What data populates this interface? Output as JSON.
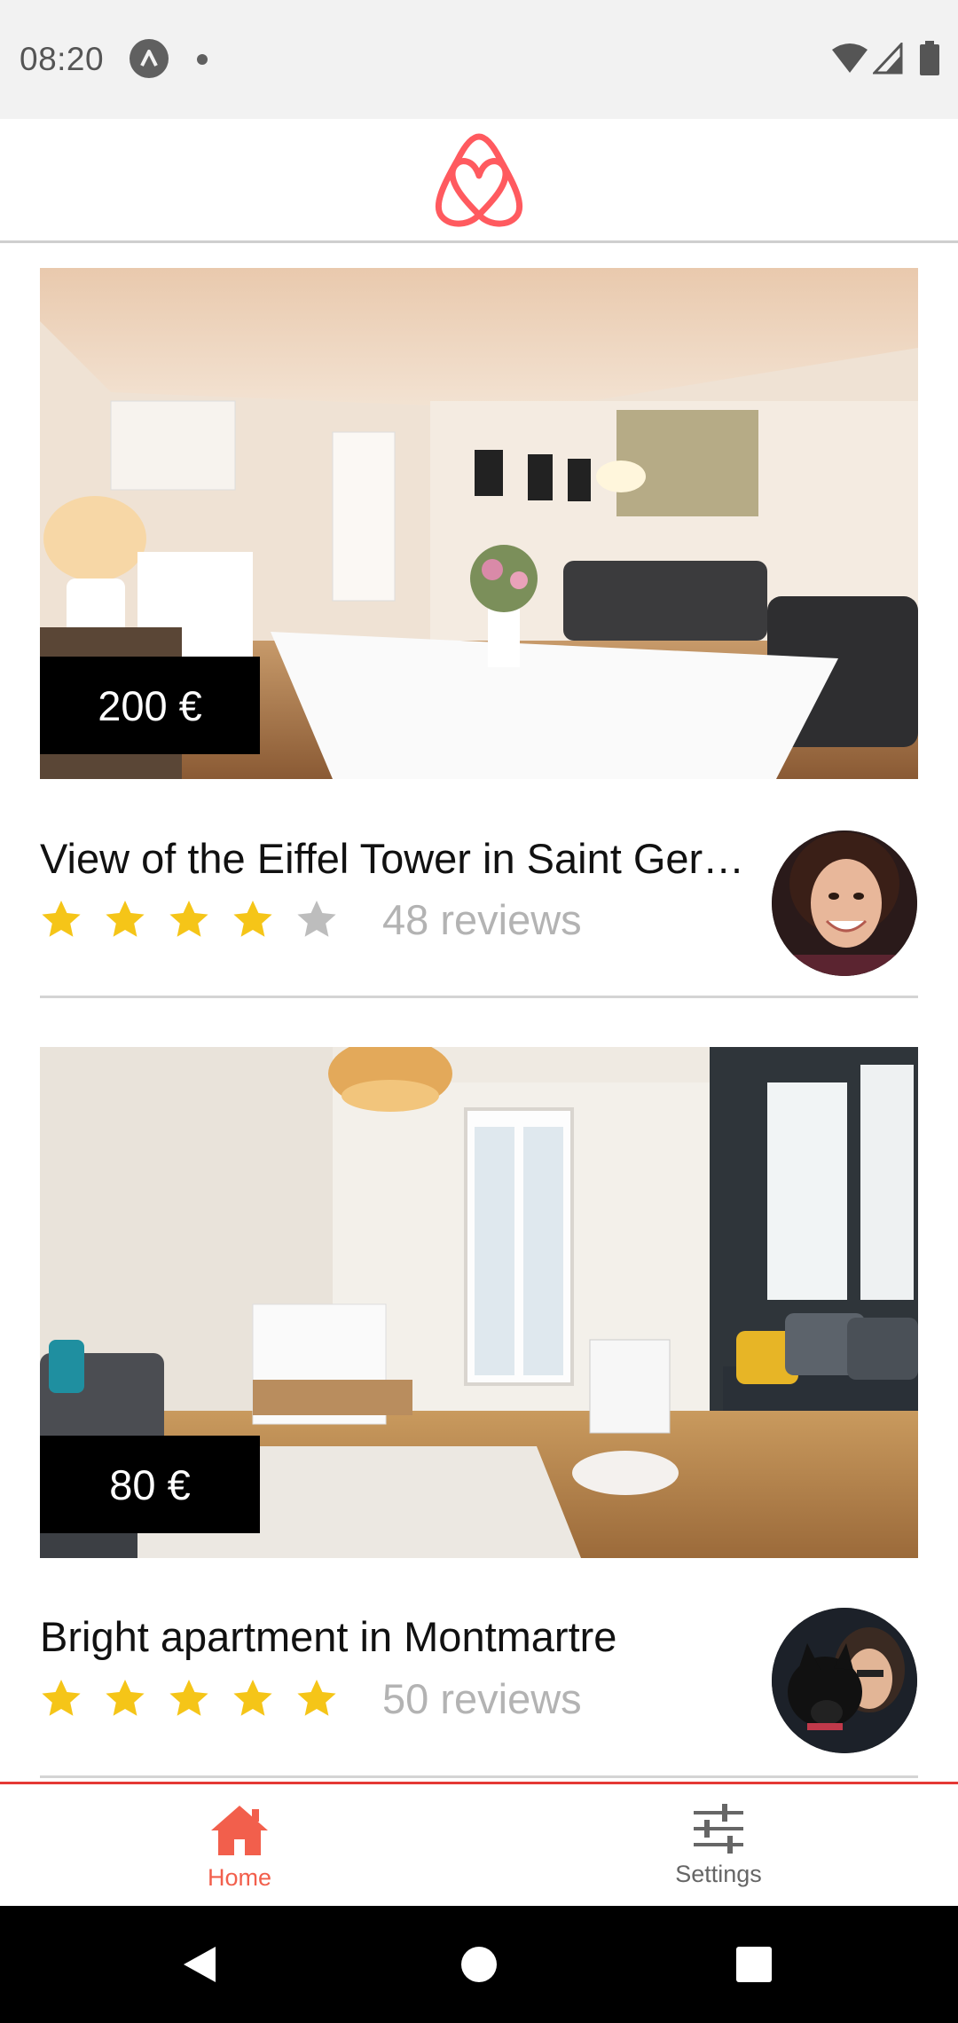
{
  "status_bar": {
    "time": "08:20",
    "icons": [
      "app-notification-icon",
      "dot-icon",
      "wifi-icon",
      "signal-icon",
      "battery-icon"
    ]
  },
  "header": {
    "logo": "airbnb-logo",
    "logo_color": "#ff5a5f"
  },
  "listings": [
    {
      "price": "200 €",
      "title": "View of the Eiffel Tower in Saint Ger…",
      "rating": 4,
      "max_rating": 5,
      "reviews": "48 reviews",
      "image": "living-room-photo"
    },
    {
      "price": "80 €",
      "title": "Bright apartment in Montmartre",
      "rating": 5,
      "max_rating": 5,
      "reviews": "50 reviews",
      "image": "bright-apartment-photo"
    }
  ],
  "bottom_nav": {
    "home_label": "Home",
    "settings_label": "Settings",
    "active": "Home",
    "accent_color": "#f25f4c"
  },
  "colors": {
    "star_filled": "#f5c518",
    "star_empty": "#bdbdbd",
    "review_text": "#b3b3b3"
  }
}
